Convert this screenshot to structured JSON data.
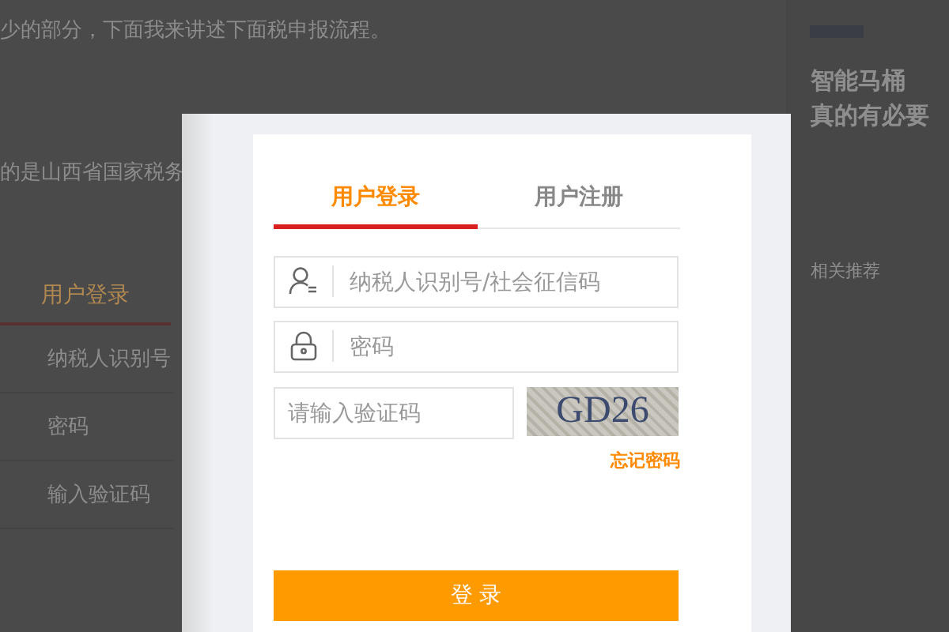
{
  "background_page": {
    "article_lines": [
      "少的部分，下面我来讲述下面税申报流程。",
      "的是山西省国家税务"
    ],
    "login_form": {
      "tab": "用户登录",
      "fields": [
        "纳税人识别号",
        "密码"
      ],
      "captcha_placeholder": "输入验证码"
    },
    "sidebar": {
      "headline_lines": [
        "智能马桶",
        "真的有必要"
      ],
      "section_title": "相关推荐"
    }
  },
  "dialog": {
    "tabs": [
      {
        "label": "用户登录",
        "selected": true
      },
      {
        "label": "用户注册",
        "selected": false
      }
    ],
    "fields": [
      {
        "kind": "user",
        "placeholder": "纳税人识别号/社会征信码"
      },
      {
        "kind": "lock",
        "placeholder": "密码"
      }
    ],
    "captcha": {
      "placeholder": "请输入验证码",
      "code": "GD26"
    },
    "forgot_link": "忘记密码",
    "login_button": "登 录"
  }
}
